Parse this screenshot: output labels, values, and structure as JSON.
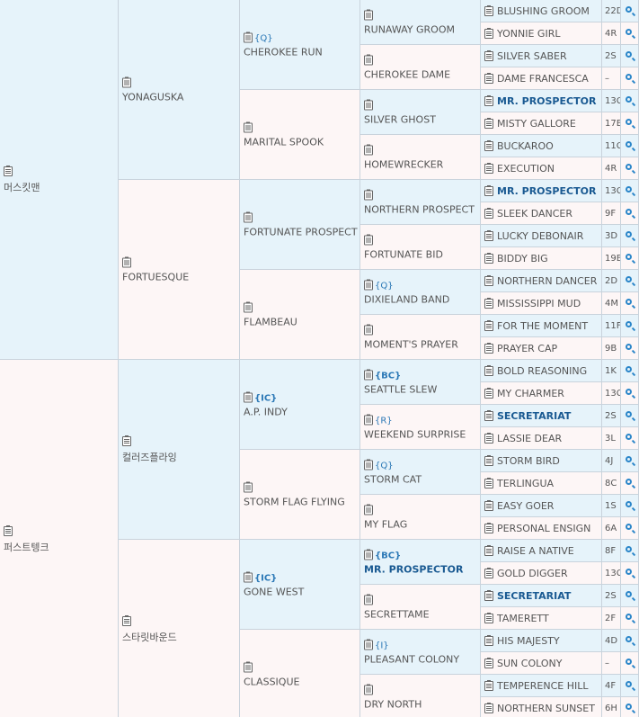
{
  "gen1": [
    {
      "name": "머스킷맨",
      "tag": ""
    },
    {
      "name": "퍼스트텡크",
      "tag": ""
    }
  ],
  "gen2": [
    {
      "name": "YONAGUSKA",
      "tag": ""
    },
    {
      "name": "FORTUESQUE",
      "tag": ""
    },
    {
      "name": "컬러즈플라잉",
      "tag": ""
    },
    {
      "name": "스타릿바운드",
      "tag": ""
    }
  ],
  "gen3": [
    {
      "name": "CHEROKEE RUN",
      "tag": "{Q}"
    },
    {
      "name": "MARITAL SPOOK",
      "tag": ""
    },
    {
      "name": "FORTUNATE PROSPECT",
      "tag": ""
    },
    {
      "name": "FLAMBEAU",
      "tag": ""
    },
    {
      "name": "A.P. INDY",
      "tag": "{IC}"
    },
    {
      "name": "STORM FLAG FLYING",
      "tag": ""
    },
    {
      "name": "GONE WEST",
      "tag": "{IC}"
    },
    {
      "name": "CLASSIQUE",
      "tag": ""
    }
  ],
  "gen4": [
    {
      "name": "RUNAWAY GROOM",
      "tag": ""
    },
    {
      "name": "CHEROKEE DAME",
      "tag": ""
    },
    {
      "name": "SILVER GHOST",
      "tag": ""
    },
    {
      "name": "HOMEWRECKER",
      "tag": ""
    },
    {
      "name": "NORTHERN PROSPECT",
      "tag": ""
    },
    {
      "name": "FORTUNATE BID",
      "tag": ""
    },
    {
      "name": "DIXIELAND BAND",
      "tag": "{Q}"
    },
    {
      "name": "MOMENT'S PRAYER",
      "tag": ""
    },
    {
      "name": "SEATTLE SLEW",
      "tag": "{BC}"
    },
    {
      "name": "WEEKEND SURPRISE",
      "tag": "{R}"
    },
    {
      "name": "STORM CAT",
      "tag": "{Q}"
    },
    {
      "name": "MY FLAG",
      "tag": ""
    },
    {
      "name": "MR. PROSPECTOR",
      "tag": "{BC}"
    },
    {
      "name": "SECRETTAME",
      "tag": ""
    },
    {
      "name": "PLEASANT COLONY",
      "tag": "{I}"
    },
    {
      "name": "DRY NORTH",
      "tag": ""
    }
  ],
  "gen5": [
    {
      "name": "BLUSHING GROOM",
      "code": "22D"
    },
    {
      "name": "YONNIE GIRL",
      "code": "4R"
    },
    {
      "name": "SILVER SABER",
      "code": "2S"
    },
    {
      "name": "DAME FRANCESCA",
      "code": "–"
    },
    {
      "name": "MR. PROSPECTOR",
      "code": "13C"
    },
    {
      "name": "MISTY GALLORE",
      "code": "17B"
    },
    {
      "name": "BUCKAROO",
      "code": "11C"
    },
    {
      "name": "EXECUTION",
      "code": "4R"
    },
    {
      "name": "MR. PROSPECTOR",
      "code": "13C"
    },
    {
      "name": "SLEEK DANCER",
      "code": "9F"
    },
    {
      "name": "LUCKY DEBONAIR",
      "code": "3D"
    },
    {
      "name": "BIDDY BIG",
      "code": "19B"
    },
    {
      "name": "NORTHERN DANCER",
      "code": "2D"
    },
    {
      "name": "MISSISSIPPI MUD",
      "code": "4M"
    },
    {
      "name": "FOR THE MOMENT",
      "code": "11F"
    },
    {
      "name": "PRAYER CAP",
      "code": "9B"
    },
    {
      "name": "BOLD REASONING",
      "code": "1K"
    },
    {
      "name": "MY CHARMER",
      "code": "13C"
    },
    {
      "name": "SECRETARIAT",
      "code": "2S"
    },
    {
      "name": "LASSIE DEAR",
      "code": "3L"
    },
    {
      "name": "STORM BIRD",
      "code": "4J"
    },
    {
      "name": "TERLINGUA",
      "code": "8C"
    },
    {
      "name": "EASY GOER",
      "code": "1S"
    },
    {
      "name": "PERSONAL ENSIGN",
      "code": "6A"
    },
    {
      "name": "RAISE A NATIVE",
      "code": "8F"
    },
    {
      "name": "GOLD DIGGER",
      "code": "13C"
    },
    {
      "name": "SECRETARIAT",
      "code": "2S"
    },
    {
      "name": "TAMERETT",
      "code": "2F"
    },
    {
      "name": "HIS MAJESTY",
      "code": "4D"
    },
    {
      "name": "SUN COLONY",
      "code": "–"
    },
    {
      "name": "TEMPERENCE HILL",
      "code": "4F"
    },
    {
      "name": "NORTHERN SUNSET",
      "code": "6H"
    }
  ]
}
